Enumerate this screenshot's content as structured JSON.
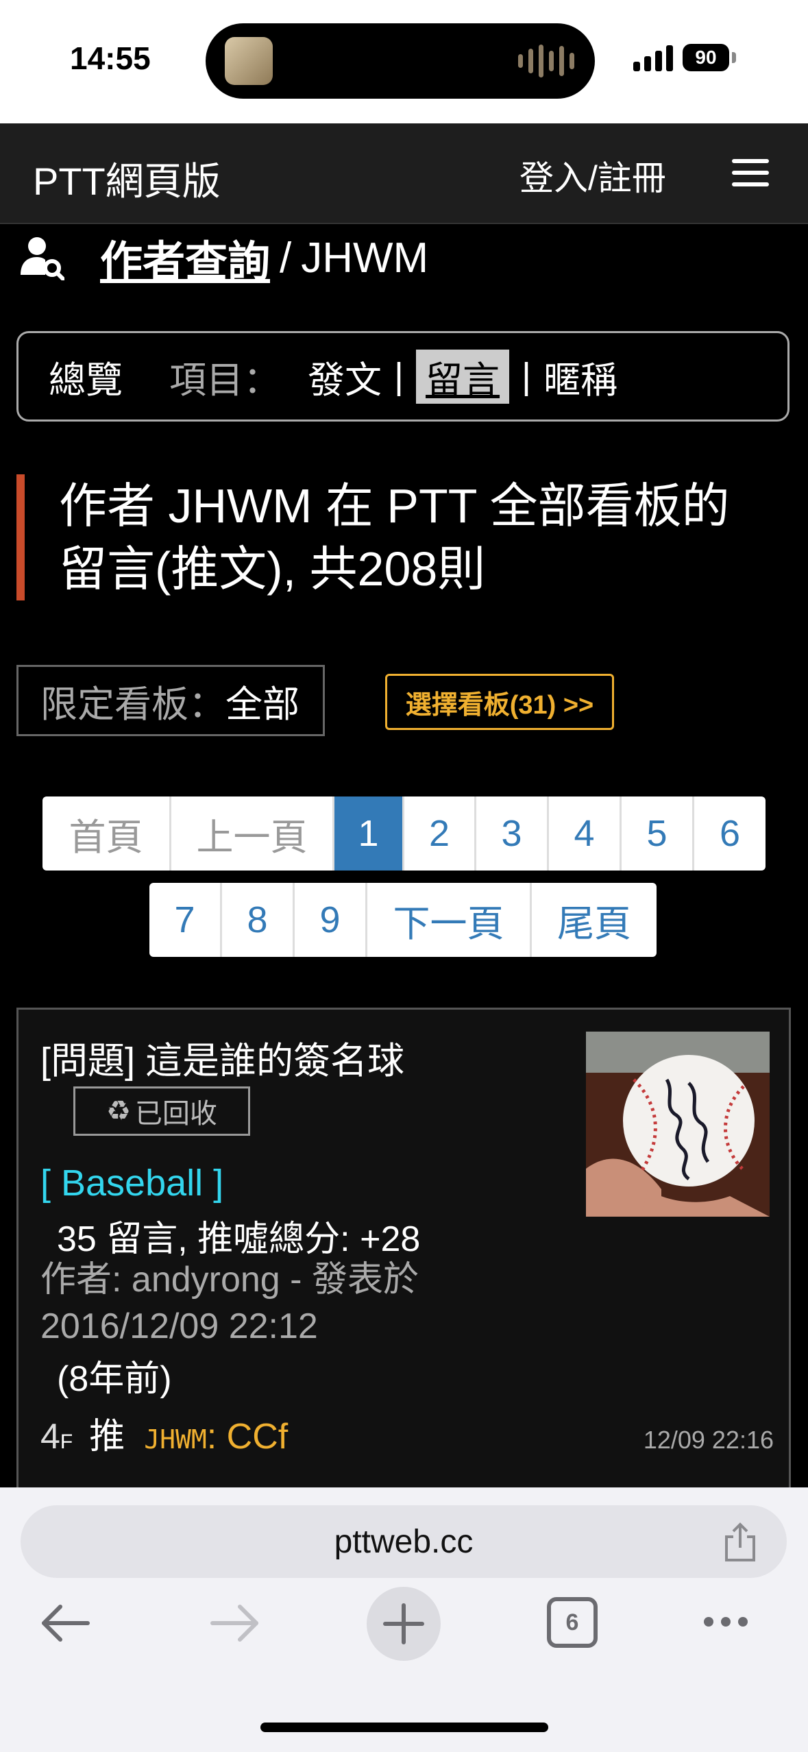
{
  "status_bar": {
    "time": "14:55",
    "battery": "90"
  },
  "nav": {
    "brand": "PTT網頁版",
    "login": "登入/註冊"
  },
  "search": {
    "section": "作者查詢",
    "separator": "/",
    "author": "JHWM"
  },
  "filter": {
    "overview": "總覽",
    "items_label": "項目：",
    "posts": "發文",
    "comments": "留言",
    "nickname": "暱稱",
    "pipe": "|",
    "active": "留言"
  },
  "heading": {
    "line1": "作者 JHWM 在 PTT 全部看板的",
    "line2": "留言(推文), 共208則"
  },
  "board_filter": {
    "label": "限定看板：",
    "value": "全部",
    "choose": "選擇看板(31) >>"
  },
  "pagination": {
    "first": "首頁",
    "prev": "上一頁",
    "pages": [
      "1",
      "2",
      "3",
      "4",
      "5",
      "6",
      "7",
      "8",
      "9"
    ],
    "current": "1",
    "next": "下一頁",
    "last": "尾頁"
  },
  "result": {
    "title": "[問題] 這是誰的簽名球",
    "recycled": "已回收",
    "board": "[ Baseball ]",
    "stats": "35 留言, 推噓總分: +28",
    "author_line": "作者: andyrong - 發表於 2016/12/09 22:12",
    "age": "(8年前)",
    "push": {
      "floor": "4",
      "floor_suffix": "F",
      "tag": "推",
      "user": "JHWM",
      "text": ": CCf",
      "time": "12/09 22:16"
    }
  },
  "browser": {
    "url": "pttweb.cc",
    "tabs": "6"
  },
  "colors": {
    "accent_blue": "#337ab7",
    "board_cyan": "#33d6ee",
    "push_yellow": "#f0b030",
    "title_bar_red": "#c94b2a"
  }
}
